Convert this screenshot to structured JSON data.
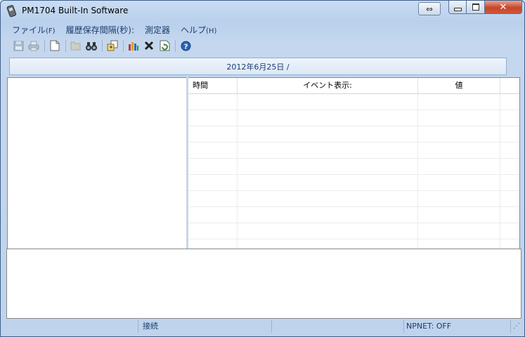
{
  "window": {
    "title": "PM1704 Built-In Software",
    "controls": {
      "swap": "⇔",
      "minimize": "▭",
      "maximize": "▢",
      "close": "✕"
    }
  },
  "menu": [
    {
      "label": "ファイル",
      "accel": "(F)"
    },
    {
      "label": "履歴保存間隔(秒):",
      "accel": ""
    },
    {
      "label": "測定器",
      "accel": ""
    },
    {
      "label": "ヘルプ",
      "accel": "(H)"
    }
  ],
  "toolbar": {
    "icons": [
      "save-icon",
      "print-icon",
      "new-document-icon",
      "open-folder-icon",
      "find-icon",
      "export-icon",
      "chart-icon",
      "delete-icon",
      "refresh-icon",
      "help-icon"
    ]
  },
  "datebar": {
    "text": "2012年6月25日 /"
  },
  "events_table": {
    "headers": [
      "時間",
      "イベント表示:",
      "値",
      ""
    ],
    "rows": 10
  },
  "status": {
    "panels": [
      "",
      "接続",
      "",
      "NPNET: OFF"
    ]
  },
  "colors": {
    "accent": "#1b3c6e",
    "close_button": "#c7462a",
    "frame": "#c4d7ee"
  }
}
